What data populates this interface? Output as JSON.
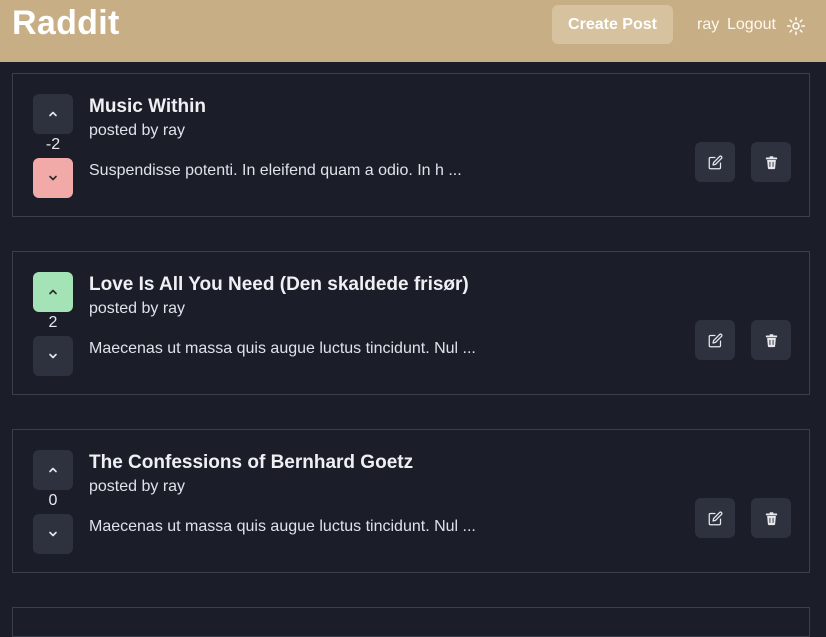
{
  "app": {
    "brand": "Raddit"
  },
  "header": {
    "create_label": "Create Post",
    "username": "ray",
    "logout_label": "Logout",
    "theme_icon": "sun-icon"
  },
  "posts": [
    {
      "score": "-2",
      "vote": "down",
      "title": "Music Within",
      "byline": "posted by ray",
      "excerpt": "Suspendisse potenti. In eleifend quam a odio. In h ..."
    },
    {
      "score": "2",
      "vote": "up",
      "title": "Love Is All You Need (Den skaldede frisør)",
      "byline": "posted by ray",
      "excerpt": "Maecenas ut massa quis augue luctus tincidunt. Nul ..."
    },
    {
      "score": "0",
      "vote": "none",
      "title": "The Confessions of Bernhard Goetz",
      "byline": "posted by ray",
      "excerpt": "Maecenas ut massa quis augue luctus tincidunt. Nul ..."
    }
  ],
  "colors": {
    "header": "#c8ae85",
    "background": "#1b1e29",
    "downvoted": "#f1aaa8",
    "upvoted": "#a4e3b6"
  }
}
